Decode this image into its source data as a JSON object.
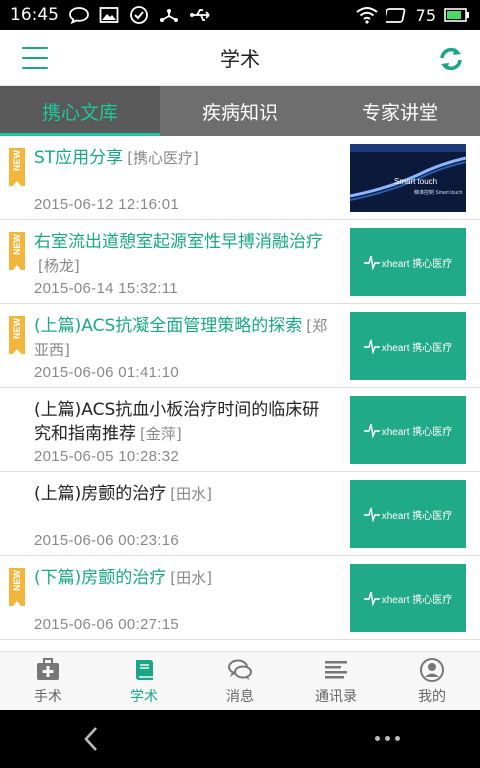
{
  "status_bar": {
    "time": "16:45",
    "battery": "75"
  },
  "header": {
    "title": "学术"
  },
  "tabs": [
    {
      "label": "携心文库",
      "active": true
    },
    {
      "label": "疾病知识",
      "active": false
    },
    {
      "label": "专家讲堂",
      "active": false
    }
  ],
  "badge_label": "NEW",
  "thumb_brand": "xheart 携心医疗",
  "promo_thumb": {
    "title": "Smart touch",
    "subtitle": "精准控制 Smart touch"
  },
  "articles": [
    {
      "title": "ST应用分享",
      "author": "[携心医疗]",
      "date": "2015-06-12 12:16:01",
      "is_new": true,
      "highlighted": true,
      "thumb": "promo"
    },
    {
      "title": "右室流出道憩室起源室性早搏消融治疗",
      "author": "[杨龙]",
      "date": "2015-06-14 15:32:11",
      "is_new": true,
      "highlighted": true,
      "thumb": "brand"
    },
    {
      "title": "(上篇)ACS抗凝全面管理策略的探索",
      "author": "[郑亚西]",
      "date": "2015-06-06 01:41:10",
      "is_new": true,
      "highlighted": true,
      "thumb": "brand"
    },
    {
      "title": "(上篇)ACS抗血小板治疗时间的临床研究和指南推荐",
      "author": "[金萍]",
      "date": "2015-06-05 10:28:32",
      "is_new": false,
      "highlighted": false,
      "thumb": "brand"
    },
    {
      "title": "(上篇)房颤的治疗",
      "author": "[田水]",
      "date": "2015-06-06 00:23:16",
      "is_new": false,
      "highlighted": false,
      "thumb": "brand"
    },
    {
      "title": "(下篇)房颤的治疗",
      "author": "[田水]",
      "date": "2015-06-06 00:27:15",
      "is_new": true,
      "highlighted": true,
      "thumb": "brand"
    }
  ],
  "bottom_nav": [
    {
      "label": "手术",
      "icon": "medkit-icon",
      "active": false
    },
    {
      "label": "学术",
      "icon": "book-icon",
      "active": true
    },
    {
      "label": "消息",
      "icon": "chat-icon",
      "active": false
    },
    {
      "label": "通讯录",
      "icon": "contacts-icon",
      "active": false
    },
    {
      "label": "我的",
      "icon": "profile-icon",
      "active": false
    }
  ],
  "colors": {
    "accent": "#1aa787",
    "tab_bar": "#6e6e6e",
    "badge": "#f2b63c",
    "thumb": "#21aa88"
  }
}
